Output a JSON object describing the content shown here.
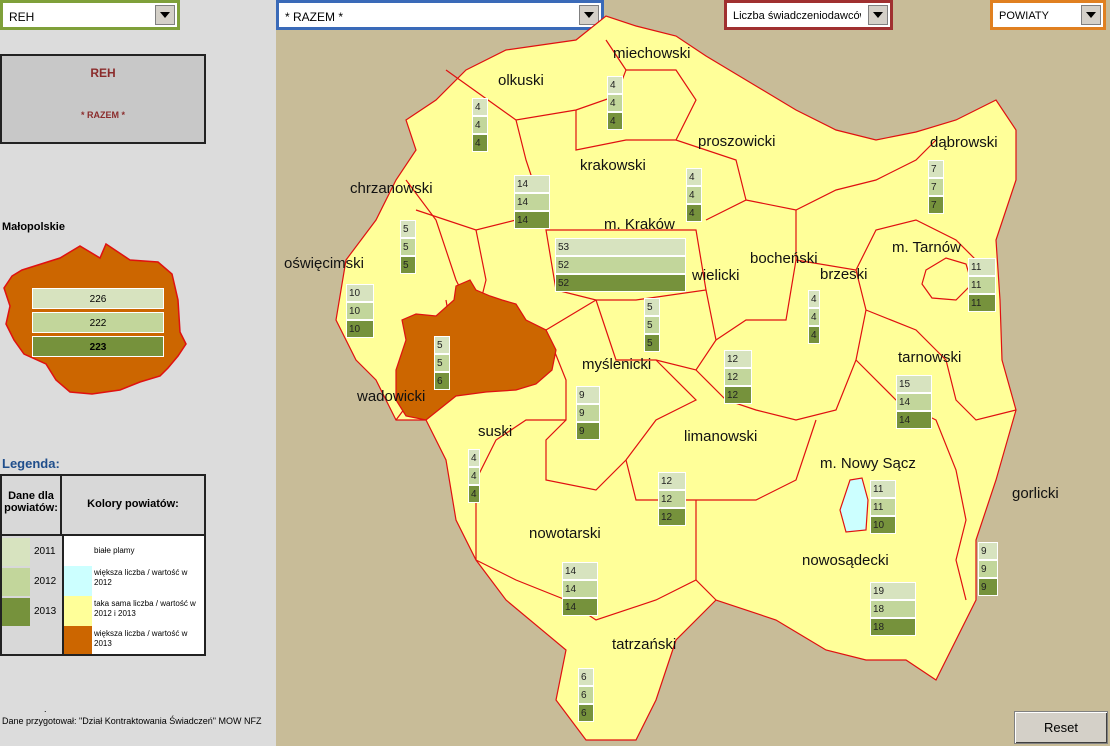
{
  "controls": {
    "service": "REH",
    "scope": "* RAZEM *",
    "measure": "Liczba świadczeniodawców",
    "level": "POWIATY",
    "reset": "Reset"
  },
  "info": {
    "title": "REH",
    "subtitle": "* RAZEM *"
  },
  "region": {
    "name": "Małopolskie",
    "values": [
      "226",
      "222",
      "223"
    ]
  },
  "legend": {
    "title": "Legenda:",
    "data_header": "Dane dla powiatów:",
    "colors_header": "Kolory powiatów:",
    "years": [
      "2011",
      "2012",
      "2013"
    ],
    "items": [
      {
        "color": "#ffffff",
        "label": "białe plamy"
      },
      {
        "color": "#ccffff",
        "label": "większa liczba / wartość w 2012"
      },
      {
        "color": "#ffff99",
        "label": "taka sama liczba / wartość w 2012 i 2013"
      },
      {
        "color": "#cc6600",
        "label": "większa liczba / wartość w 2013"
      }
    ]
  },
  "colors": {
    "y2011": "#d7e3bf",
    "y2012": "#c2d69b",
    "y2013": "#76923c",
    "same": "#ffff99",
    "more2013": "#cc6600",
    "more2012": "#ccffff",
    "border": "#e01010"
  },
  "footer": "Dane przygotował: \"Dział Kontraktowania Świadczeń\" MOW NFZ",
  "footer_dot": ".",
  "districts": [
    {
      "name": "miechowski",
      "values": [
        4,
        4,
        4
      ]
    },
    {
      "name": "olkuski",
      "values": [
        4,
        4,
        4
      ]
    },
    {
      "name": "proszowicki",
      "values": [
        4,
        4,
        4
      ]
    },
    {
      "name": "dąbrowski",
      "values": [
        7,
        7,
        7
      ]
    },
    {
      "name": "krakowski",
      "values": [
        14,
        14,
        14
      ]
    },
    {
      "name": "chrzanowski",
      "values": [
        5,
        5,
        5
      ]
    },
    {
      "name": "m. Kraków",
      "values": [
        53,
        52,
        52
      ]
    },
    {
      "name": "m. Tarnów",
      "values": [
        11,
        11,
        11
      ]
    },
    {
      "name": "oświęcimski",
      "values": [
        10,
        10,
        10
      ]
    },
    {
      "name": "wielicki",
      "values": [
        5,
        5,
        5
      ]
    },
    {
      "name": "bocheński",
      "values": [
        4,
        4,
        4
      ]
    },
    {
      "name": "brzeski",
      "values": [
        12,
        12,
        12
      ]
    },
    {
      "name": "wadowicki",
      "values": [
        5,
        5,
        6
      ]
    },
    {
      "name": "myślenicki",
      "values": [
        9,
        9,
        9
      ]
    },
    {
      "name": "tarnowski",
      "values": [
        15,
        14,
        14
      ]
    },
    {
      "name": "suski",
      "values": [
        4,
        4,
        4
      ]
    },
    {
      "name": "limanowski",
      "values": [
        12,
        12,
        12
      ]
    },
    {
      "name": "m. Nowy Sącz",
      "values": [
        11,
        11,
        10
      ]
    },
    {
      "name": "gorlicki",
      "values": [
        9,
        9,
        9
      ]
    },
    {
      "name": "nowotarski",
      "values": [
        14,
        14,
        14
      ]
    },
    {
      "name": "nowosądecki",
      "values": [
        19,
        18,
        18
      ]
    },
    {
      "name": "tatrzański",
      "values": [
        6,
        6,
        6
      ]
    }
  ]
}
